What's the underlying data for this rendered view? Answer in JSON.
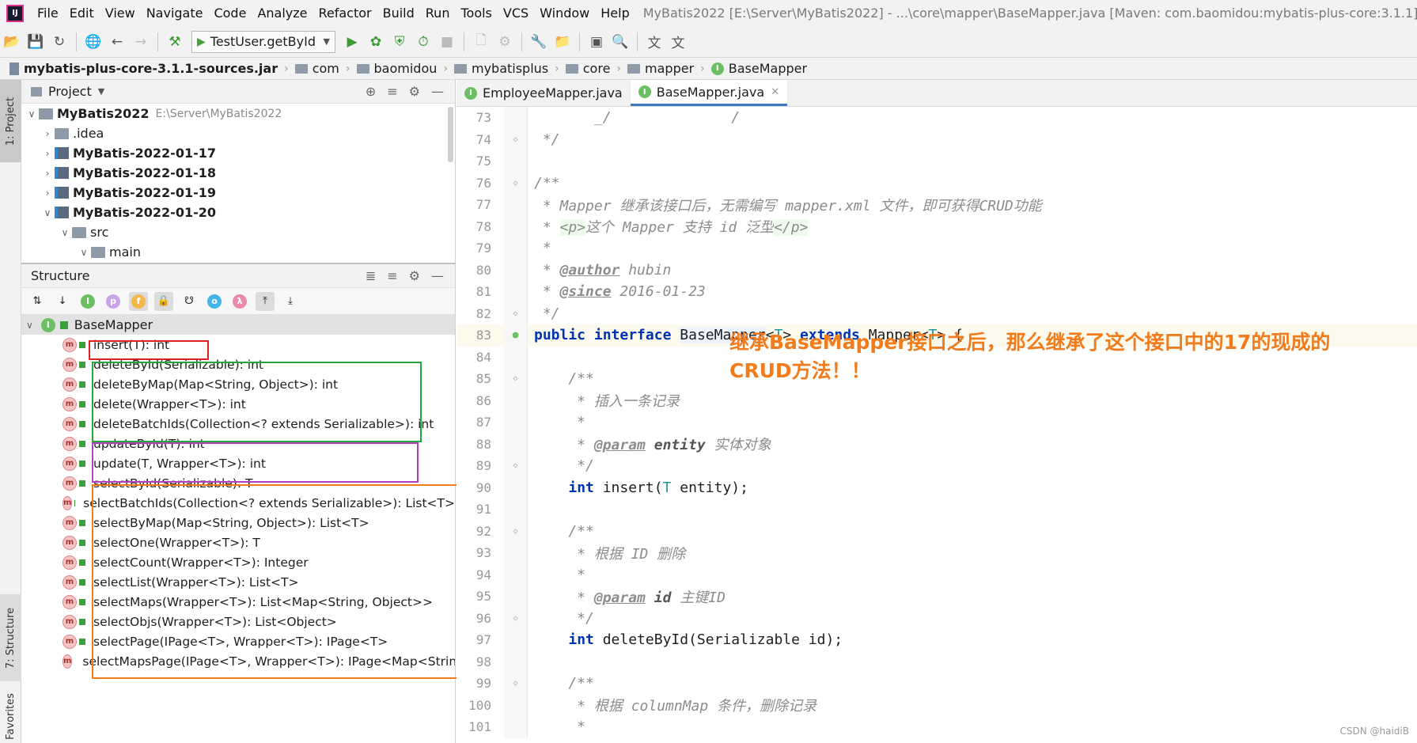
{
  "window": {
    "logo": "IJ",
    "menus": [
      "File",
      "Edit",
      "View",
      "Navigate",
      "Code",
      "Analyze",
      "Refactor",
      "Build",
      "Run",
      "Tools",
      "VCS",
      "Window",
      "Help"
    ],
    "title": "MyBatis2022 [E:\\Server\\MyBatis2022] - ...\\core\\mapper\\BaseMapper.java [Maven: com.baomidou:mybatis-plus-core:3.1.1]"
  },
  "toolbar": {
    "run_config": "TestUser.getById"
  },
  "breadcrumb": [
    "mybatis-plus-core-3.1.1-sources.jar",
    "com",
    "baomidou",
    "mybatisplus",
    "core",
    "mapper",
    "BaseMapper"
  ],
  "side_tabs": {
    "project": "1: Project",
    "structure": "7: Structure",
    "favorites": "Favorites"
  },
  "project": {
    "title": "Project",
    "rows": [
      {
        "label": "MyBatis2022",
        "path": "E:\\Server\\MyBatis2022"
      },
      {
        "label": ".idea"
      },
      {
        "label": "MyBatis-2022-01-17"
      },
      {
        "label": "MyBatis-2022-01-18"
      },
      {
        "label": "MyBatis-2022-01-19"
      },
      {
        "label": "MyBatis-2022-01-20"
      },
      {
        "label": "src"
      },
      {
        "label": "main"
      }
    ]
  },
  "structure": {
    "title": "Structure",
    "root": "BaseMapper",
    "methods": [
      "insert(T): int",
      "deleteById(Serializable): int",
      "deleteByMap(Map<String, Object>): int",
      "delete(Wrapper<T>): int",
      "deleteBatchIds(Collection<? extends Serializable>): int",
      "updateById(T): int",
      "update(T, Wrapper<T>): int",
      "selectById(Serializable): T",
      "selectBatchIds(Collection<? extends Serializable>): List<T>",
      "selectByMap(Map<String, Object>): List<T>",
      "selectOne(Wrapper<T>): T",
      "selectCount(Wrapper<T>): Integer",
      "selectList(Wrapper<T>): List<T>",
      "selectMaps(Wrapper<T>): List<Map<String, Object>>",
      "selectObjs(Wrapper<T>): List<Object>",
      "selectPage(IPage<T>, Wrapper<T>): IPage<T>",
      "selectMapsPage(IPage<T>, Wrapper<T>): IPage<Map<String,"
    ],
    "box_colors": {
      "insert": "#e02020",
      "delete": "#22a83a",
      "update": "#b040c0",
      "select": "#f07c1e"
    }
  },
  "editor": {
    "tabs": [
      {
        "label": "EmployeeMapper.java"
      },
      {
        "label": "BaseMapper.java"
      }
    ],
    "current_line": 83,
    "lines": [
      {
        "n": "73",
        "t": "       _/              /"
      },
      {
        "n": "74",
        "t": " */"
      },
      {
        "n": "75",
        "t": ""
      },
      {
        "n": "76",
        "t": "/**"
      },
      {
        "n": "77",
        "t": " * Mapper 继承该接口后，无需编写 mapper.xml 文件，即可获得CRUD功能"
      },
      {
        "n": "78",
        "t": " * <p>这个 Mapper 支持 id 泛型</p>"
      },
      {
        "n": "79",
        "t": " *"
      },
      {
        "n": "80",
        "t": " * @author hubin"
      },
      {
        "n": "81",
        "t": " * @since 2016-01-23"
      },
      {
        "n": "82",
        "t": " */"
      },
      {
        "n": "83",
        "t": "public interface BaseMapper<T> extends Mapper<T> {"
      },
      {
        "n": "84",
        "t": ""
      },
      {
        "n": "85",
        "t": "    /**"
      },
      {
        "n": "86",
        "t": "     * 插入一条记录"
      },
      {
        "n": "87",
        "t": "     *"
      },
      {
        "n": "88",
        "t": "     * @param entity 实体对象"
      },
      {
        "n": "89",
        "t": "     */"
      },
      {
        "n": "90",
        "t": "    int insert(T entity);"
      },
      {
        "n": "91",
        "t": ""
      },
      {
        "n": "92",
        "t": "    /**"
      },
      {
        "n": "93",
        "t": "     * 根据 ID 删除"
      },
      {
        "n": "94",
        "t": "     *"
      },
      {
        "n": "95",
        "t": "     * @param id 主键ID"
      },
      {
        "n": "96",
        "t": "     */"
      },
      {
        "n": "97",
        "t": "    int deleteById(Serializable id);"
      },
      {
        "n": "98",
        "t": ""
      },
      {
        "n": "99",
        "t": "    /**"
      },
      {
        "n": "100",
        "t": "     * 根据 columnMap 条件，删除记录"
      },
      {
        "n": "101",
        "t": "     *"
      }
    ]
  },
  "annotation": {
    "line1": "继承BaseMapper接口之后，那么继承了这个接口中的17的现成的",
    "line2": "CRUD方法！！"
  },
  "watermark": "CSDN @haidiB"
}
